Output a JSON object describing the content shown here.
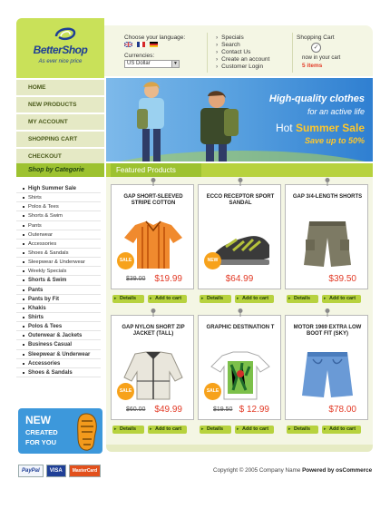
{
  "logo": {
    "brand": "BetterShop",
    "tagline": "As ever nice price"
  },
  "topbar": {
    "language_title": "Choose your language:",
    "flags": [
      "uk-flag-icon",
      "france-flag-icon",
      "germany-flag-icon"
    ],
    "currency_title": "Currencies:",
    "currency_value": "US Dollar",
    "links": [
      "Specials",
      "Search",
      "Contact Us",
      "Create an account",
      "Customer Login"
    ],
    "cart": {
      "title": "Shopping Cart",
      "icon": "cart-icon",
      "now": "now in your cart",
      "items": "5 items"
    }
  },
  "nav": [
    "HOME",
    "NEW PRODUCTS",
    "MY ACCOUNT",
    "SHOPPING CART",
    "CHECKOUT"
  ],
  "banner": {
    "line1": "High-quality clothes",
    "line2": "for an active life",
    "line3a": "Hot ",
    "line3b": "Summer Sale",
    "line4": "Save up to 50%"
  },
  "categories": {
    "title": "Shop by Categorie",
    "items": [
      {
        "label": "High Summer Sale",
        "bold": true
      },
      {
        "label": "Shirts",
        "bold": false
      },
      {
        "label": "Polos & Tees",
        "bold": false
      },
      {
        "label": "Shorts & Swim",
        "bold": false
      },
      {
        "label": "Pants",
        "bold": false
      },
      {
        "label": "Outerwear",
        "bold": false
      },
      {
        "label": "Accessories",
        "bold": false
      },
      {
        "label": "Shoes & Sandals",
        "bold": false
      },
      {
        "label": "Sleepwear & Underwear",
        "bold": false
      },
      {
        "label": "Weekly Specials",
        "bold": false
      },
      {
        "label": "Shorts & Swim",
        "bold": true
      },
      {
        "label": "Pants",
        "bold": true
      },
      {
        "label": "Pants by Fit",
        "bold": true
      },
      {
        "label": "Khakis",
        "bold": true
      },
      {
        "label": "Shirts",
        "bold": true
      },
      {
        "label": "Polos & Tees",
        "bold": true
      },
      {
        "label": "Outerwear & Jackets",
        "bold": true
      },
      {
        "label": "Business Casual",
        "bold": true
      },
      {
        "label": "Sleepwear & Underwear",
        "bold": true
      },
      {
        "label": "Accessories",
        "bold": true
      },
      {
        "label": "Shoes & Sandals",
        "bold": true
      }
    ]
  },
  "promo": {
    "line1": "NEW",
    "line2": "CREATED",
    "line3": "FOR YOU"
  },
  "featured": {
    "title": "Featured Products",
    "details_label": "Details",
    "add_label": "Add to cart",
    "products": [
      {
        "title": "GAP SHORT-SLEEVED STRIPE COTTON",
        "old": "$39.00",
        "price": "$19.99",
        "badge": "SALE"
      },
      {
        "title": "ECCO RECEPTOR SPORT SANDAL",
        "old": "",
        "price": "$64.99",
        "badge": "NEW"
      },
      {
        "title": "GAP 3/4-LENGTH SHORTS",
        "old": "",
        "price": "$39.50",
        "badge": ""
      },
      {
        "title": "GAP NYLON SHORT ZIP JACKET (TALL)",
        "old": "$60.00",
        "price": "$49.99",
        "badge": "SALE"
      },
      {
        "title": "GRAPHIC DESTINATION T",
        "old": "$19.50",
        "price": "$ 12.99",
        "badge": "SALE"
      },
      {
        "title": "MOTOR 1969 EXTRA LOW BOOT FIT (SKY)",
        "old": "",
        "price": "$78.00",
        "badge": ""
      }
    ]
  },
  "payment": [
    "PayPal",
    "VISA",
    "MasterCard"
  ],
  "footer": {
    "copyright": "Copyright © 2005 Company Name ",
    "powered": "Powered by osCommerce"
  },
  "colors": {
    "green": "#9dc230",
    "light_green": "#c9e159",
    "blue": "#1f3f96",
    "price_red": "#e23a26"
  }
}
